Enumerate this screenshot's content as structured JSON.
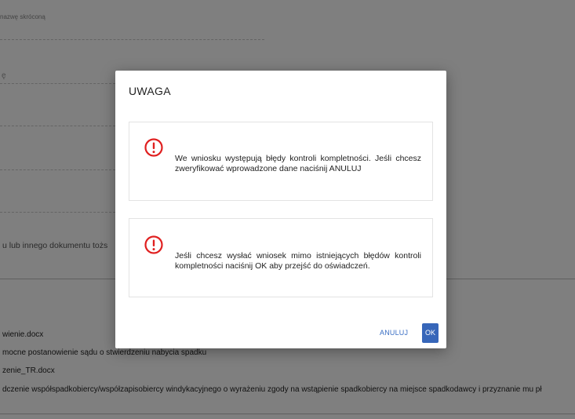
{
  "background": {
    "short_name_label": "nazwę skróconą",
    "partial_char": "ę",
    "doc_field_text": "u lub innego dokumentu tożs",
    "files": [
      "wienie.docx",
      "mocne postanowienie sądu o stwierdzeniu nabycia spadku",
      "zenie_TR.docx",
      "dczenie współspadkobiercy/współzapisobiercy windykacyjnego o wyrażeniu zgody na wstąpienie spadkobiercy na miejsce spadkodawcy i przyznanie mu pł"
    ]
  },
  "dialog": {
    "title": "UWAGA",
    "messages": [
      {
        "icon": "exclamation-circle-icon",
        "text": "We wniosku występują błędy kontroli kompletności. Jeśli chcesz zweryfikować wprowadzone dane naciśnij ANULUJ"
      },
      {
        "icon": "exclamation-circle-icon",
        "text": "Jeśli chcesz wysłać wniosek mimo istniejących błędów kontroli kompletności naciśnij OK aby przejść do oświadczeń."
      }
    ],
    "cancel_label": "ANULUJ",
    "ok_label": "OK"
  },
  "colors": {
    "accent": "#3766b9",
    "warning_icon": "#e02020"
  }
}
